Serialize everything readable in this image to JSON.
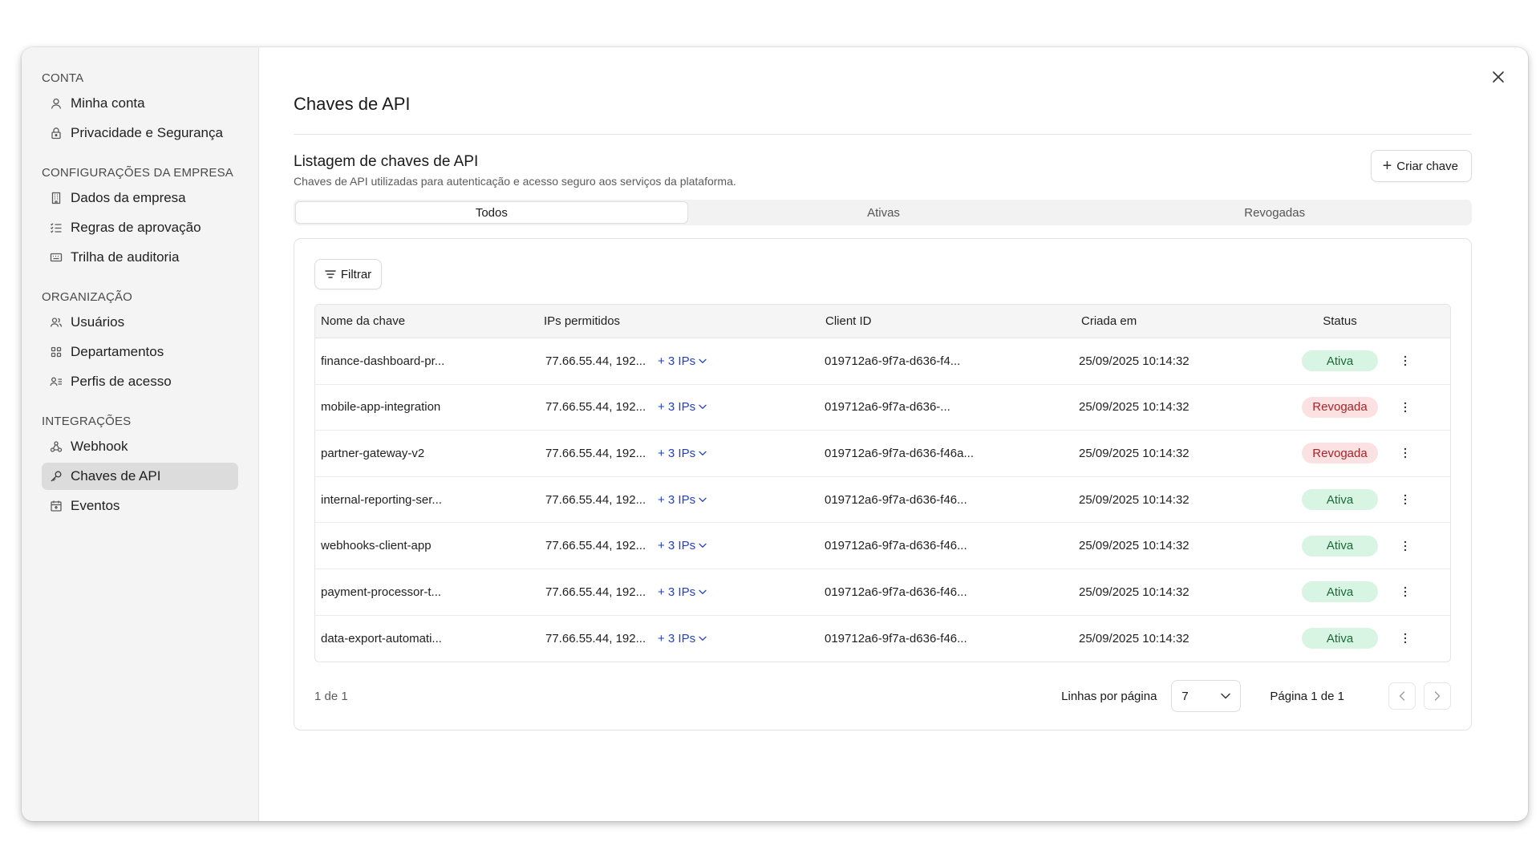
{
  "sidebar": {
    "sections": [
      {
        "label": "CONTA",
        "items": [
          {
            "label": "Minha conta",
            "icon": "user-icon"
          },
          {
            "label": "Privacidade e Segurança",
            "icon": "lock-icon"
          }
        ]
      },
      {
        "label": "CONFIGURAÇÕES DA EMPRESA",
        "items": [
          {
            "label": "Dados da empresa",
            "icon": "building-icon"
          },
          {
            "label": "Regras de aprovação",
            "icon": "checklist-icon"
          },
          {
            "label": "Trilha de auditoria",
            "icon": "keyboard-icon"
          }
        ]
      },
      {
        "label": "ORGANIZAÇÃO",
        "items": [
          {
            "label": "Usuários",
            "icon": "users-icon"
          },
          {
            "label": "Departamentos",
            "icon": "grid-icon"
          },
          {
            "label": "Perfis de acesso",
            "icon": "user-list-icon"
          }
        ]
      },
      {
        "label": "INTEGRAÇÕES",
        "items": [
          {
            "label": "Webhook",
            "icon": "webhook-icon"
          },
          {
            "label": "Chaves de API",
            "icon": "key-icon",
            "active": true
          },
          {
            "label": "Eventos",
            "icon": "calendar-icon"
          }
        ]
      }
    ]
  },
  "main": {
    "title": "Chaves de API",
    "list_title": "Listagem de chaves de API",
    "list_subtitle": "Chaves de API utilizadas para autenticação e acesso seguro aos serviços da plataforma.",
    "create_label": "Criar chave",
    "tabs": [
      {
        "label": "Todos",
        "active": true
      },
      {
        "label": "Ativas"
      },
      {
        "label": "Revogadas"
      }
    ],
    "filter_label": "Filtrar",
    "columns": {
      "name": "Nome da chave",
      "ips": "IPs permitidos",
      "client": "Client ID",
      "created": "Criada em",
      "status": "Status"
    },
    "rows": [
      {
        "name": "finance-dashboard-pr...",
        "ips": "77.66.55.44, 192...",
        "more": "+ 3 IPs",
        "client": "019712a6-9f7a-d636-f4...",
        "created": "25/09/2025 10:14:32",
        "status": "Ativa",
        "status_kind": "ativa"
      },
      {
        "name": "mobile-app-integration",
        "ips": "77.66.55.44, 192...",
        "more": "+ 3 IPs",
        "client": "019712a6-9f7a-d636-...",
        "created": "25/09/2025 10:14:32",
        "status": "Revogada",
        "status_kind": "revogada"
      },
      {
        "name": "partner-gateway-v2",
        "ips": "77.66.55.44, 192...",
        "more": "+ 3 IPs",
        "client": "019712a6-9f7a-d636-f46a...",
        "created": "25/09/2025 10:14:32",
        "status": "Revogada",
        "status_kind": "revogada"
      },
      {
        "name": "internal-reporting-ser...",
        "ips": "77.66.55.44, 192...",
        "more": "+ 3 IPs",
        "client": "019712a6-9f7a-d636-f46...",
        "created": "25/09/2025 10:14:32",
        "status": "Ativa",
        "status_kind": "ativa"
      },
      {
        "name": "webhooks-client-app",
        "ips": "77.66.55.44, 192...",
        "more": "+ 3 IPs",
        "client": "019712a6-9f7a-d636-f46...",
        "created": "25/09/2025 10:14:32",
        "status": "Ativa",
        "status_kind": "ativa"
      },
      {
        "name": "payment-processor-t...",
        "ips": "77.66.55.44, 192...",
        "more": "+ 3 IPs",
        "client": "019712a6-9f7a-d636-f46...",
        "created": "25/09/2025 10:14:32",
        "status": "Ativa",
        "status_kind": "ativa"
      },
      {
        "name": "data-export-automati...",
        "ips": "77.66.55.44, 192...",
        "more": "+ 3 IPs",
        "client": "019712a6-9f7a-d636-f46...",
        "created": "25/09/2025 10:14:32",
        "status": "Ativa",
        "status_kind": "ativa"
      }
    ],
    "footer": {
      "count": "1 de 1",
      "rows_per_page_label": "Linhas por página",
      "rows_per_page_value": "7",
      "page_label": "Página 1 de 1"
    }
  },
  "colors": {
    "accent_link": "#1f3fc7",
    "active_badge_bg": "#d7f5e2",
    "active_badge_text": "#1a6a3a",
    "revoked_badge_bg": "#fbe1e1",
    "revoked_badge_text": "#a3242a",
    "sidebar_bg": "#f4f4f4",
    "sidebar_active_bg": "#dcdcdc"
  }
}
